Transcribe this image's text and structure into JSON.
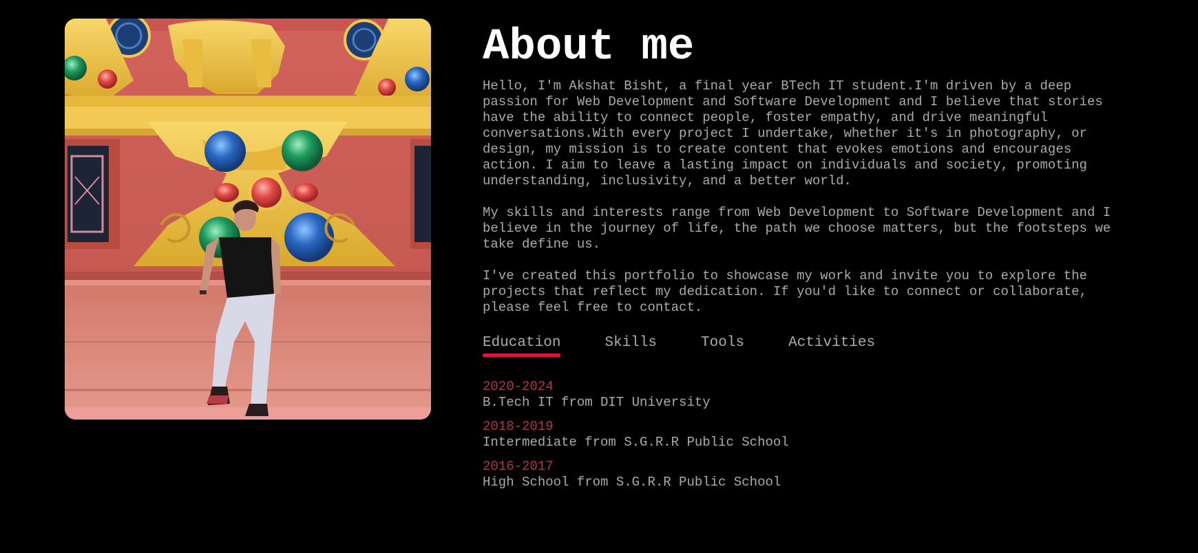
{
  "photo": {
    "alt": "Portrait photo in front of a red temple wall with golden ornaments"
  },
  "about": {
    "title": "About me",
    "paragraphs": [
      "Hello, I'm Akshat Bisht, a final year BTech IT student.I'm driven by a deep passion for Web Development and Software Development and I believe that stories have the ability to connect people, foster empathy, and drive meaningful conversations.With every project I undertake, whether it's in photography, or design, my mission is to create content that evokes emotions and encourages action. I aim to leave a lasting impact on individuals and society, promoting understanding, inclusivity, and a better world.",
      "My skills and interests range from Web Development to Software Development and I believe in the journey of life, the path we choose matters, but the footsteps we take define us.",
      "I've created this portfolio to showcase my work and invite you to explore the projects that reflect my dedication. If you'd like to connect or collaborate, please feel free to contact."
    ]
  },
  "tabs": [
    {
      "label": "Education",
      "active": true
    },
    {
      "label": "Skills",
      "active": false
    },
    {
      "label": "Tools",
      "active": false
    },
    {
      "label": "Activities",
      "active": false
    }
  ],
  "education": [
    {
      "year": "2020-2024",
      "desc": "B.Tech IT from DIT University"
    },
    {
      "year": "2018-2019",
      "desc": "Intermediate from S.G.R.R Public School"
    },
    {
      "year": "2016-2017",
      "desc": "High School from S.G.R.R Public School"
    }
  ],
  "colors": {
    "background": "#000000",
    "accent": "#e0143c",
    "year": "#b0354d",
    "text": "#ababab",
    "heading": "#ffffff"
  }
}
